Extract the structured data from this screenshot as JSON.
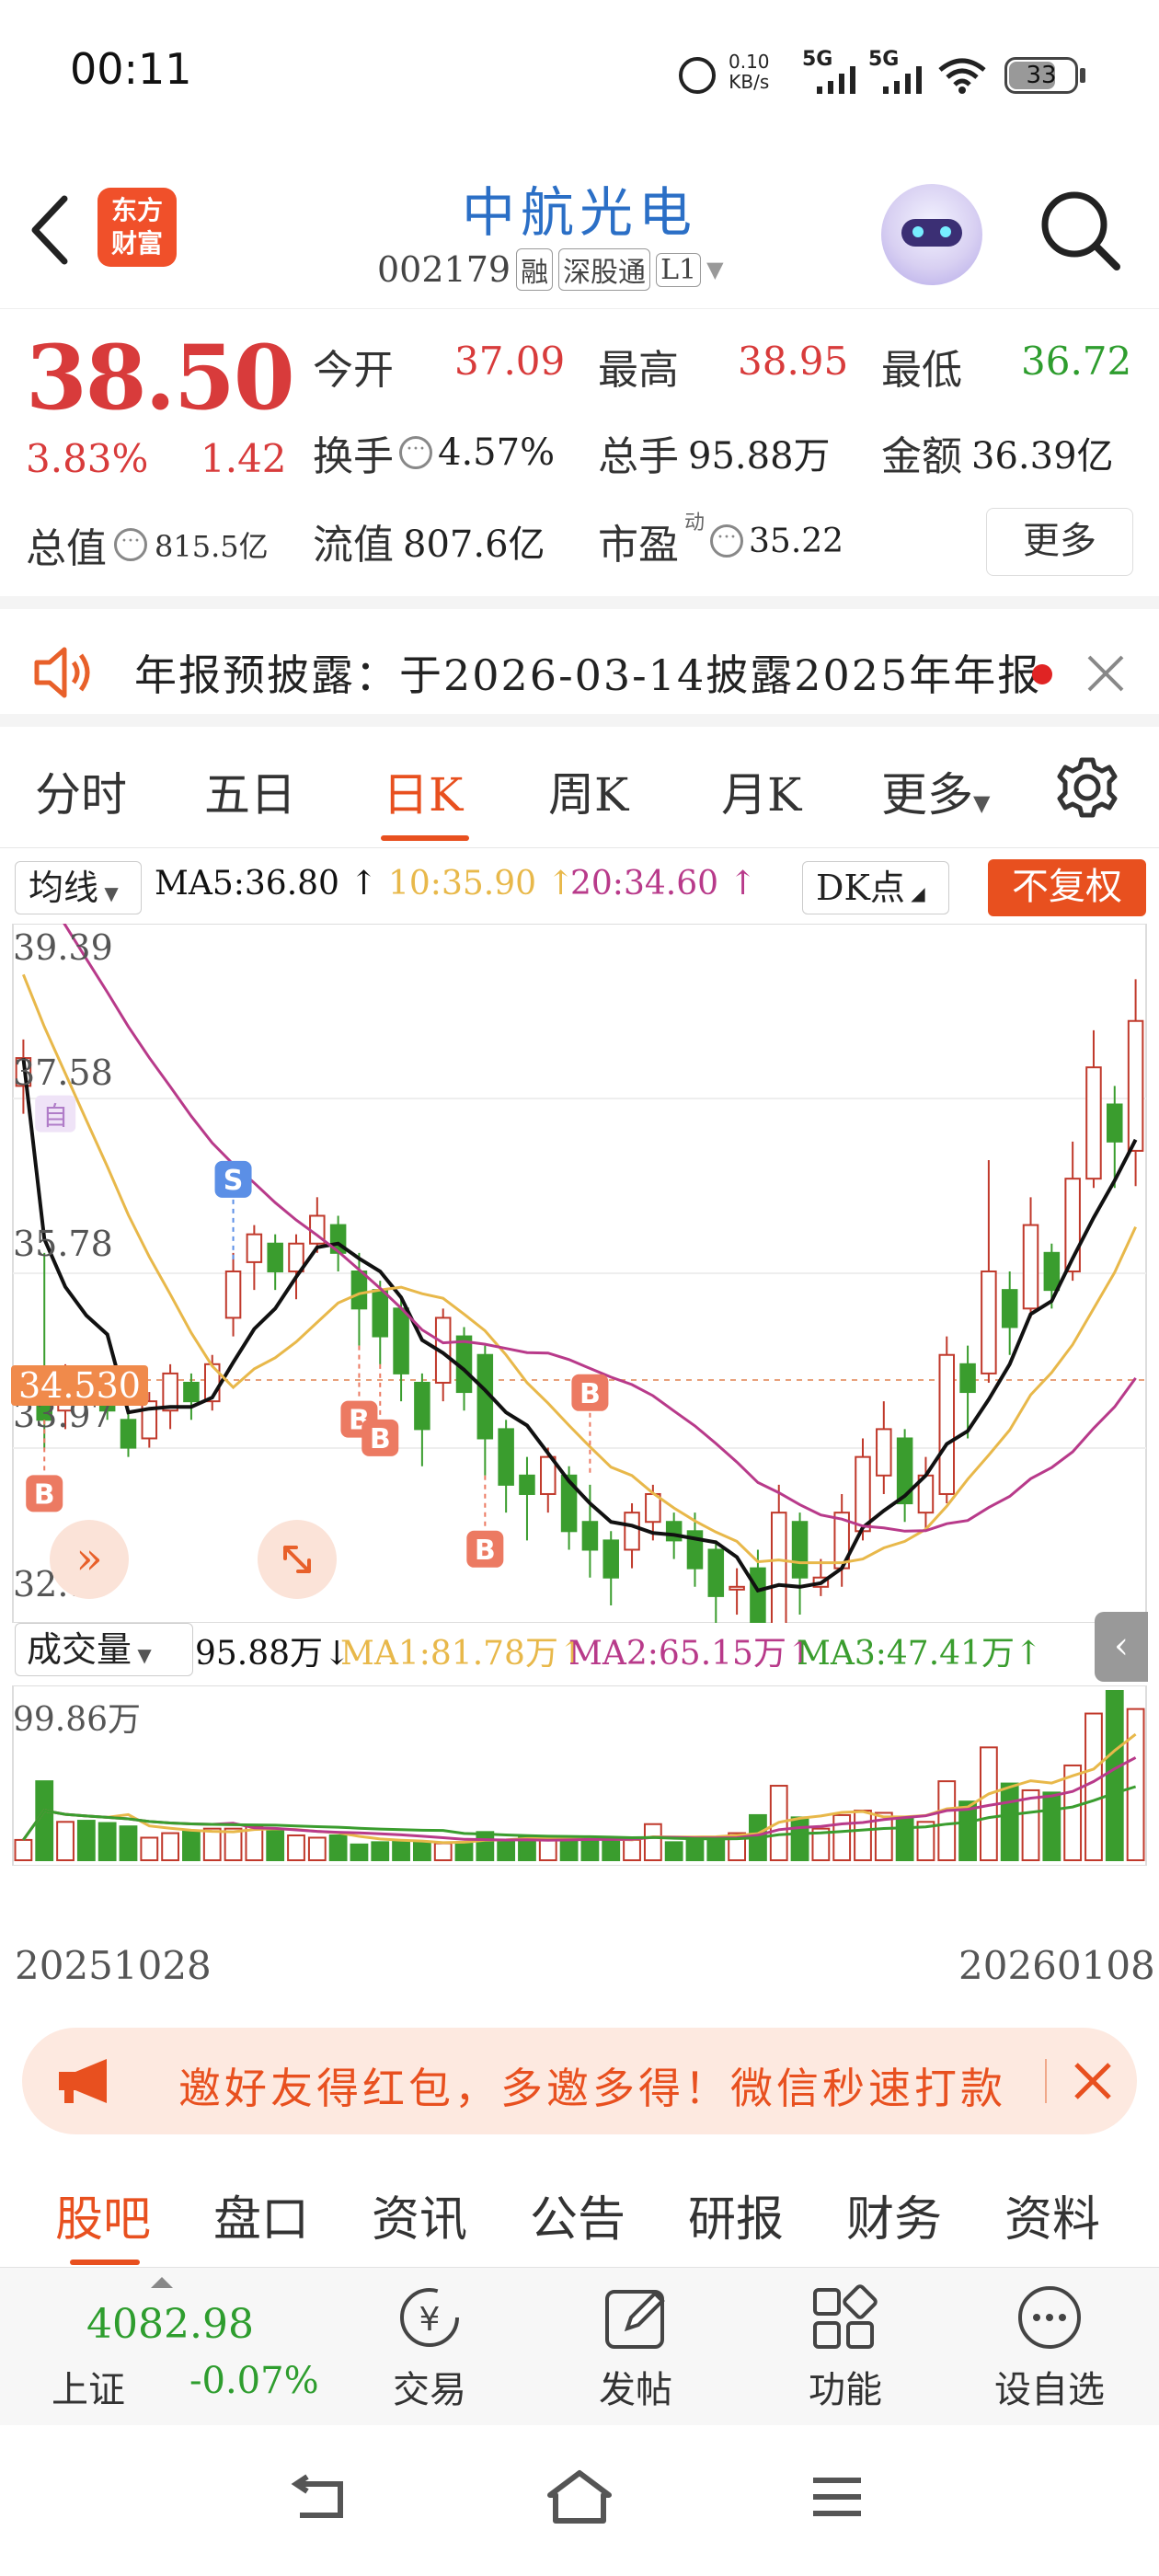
{
  "status_bar": {
    "time": "00:11",
    "net_speed_value": "0.10",
    "net_speed_unit": "KB/s",
    "sig1": "5G",
    "sig2": "5G",
    "battery": "33"
  },
  "header": {
    "logo_line1": "东方",
    "logo_line2": "财富",
    "stock_name": "中航光电",
    "stock_code": "002179",
    "tags": [
      "融",
      "深股通",
      "L1"
    ]
  },
  "quote": {
    "price": "38.50",
    "change_pct": "3.83%",
    "change_abs": "1.42",
    "open_label": "今开",
    "open_value": "37.09",
    "high_label": "最高",
    "high_value": "38.95",
    "low_label": "最低",
    "low_value": "36.72",
    "turnover_label": "换手",
    "turnover_value": "4.57%",
    "volume_label": "总手",
    "volume_value": "95.88万",
    "amount_label": "金额",
    "amount_value": "36.39亿",
    "mktcap_label": "总值",
    "mktcap_value": "815.5亿",
    "float_label": "流值",
    "float_value": "807.6亿",
    "pe_label": "市盈",
    "pe_sup": "动",
    "pe_value": "35.22",
    "more_label": "更多"
  },
  "notice": {
    "text": "年报预披露：于2026-03-14披露2025年年报"
  },
  "tabs": [
    "分时",
    "五日",
    "日K",
    "周K",
    "月K",
    "更多"
  ],
  "active_tab": "日K",
  "chart": {
    "ma_selector": "均线",
    "ma5": "MA5:36.80",
    "ma10": "10:35.90",
    "ma20": "20:34.60",
    "dk_label": "DK点",
    "adjust_label": "不复权",
    "price_current_label": "34.530",
    "y_labels": [
      "39.39",
      "37.58",
      "35.78",
      "33.97",
      "32.17"
    ],
    "vol_selector": "成交量",
    "vol_value": "95.88万",
    "vol_ma1": "MA1:81.78万",
    "vol_ma2": "MA2:65.15万",
    "vol_ma3": "MA3:47.41万",
    "vol_max_label": "99.86万",
    "date_start": "20251028",
    "date_end": "20260108",
    "marker_s": "S",
    "marker_b": "B",
    "marker_zi": "自",
    "colors": {
      "up": "#c0392b",
      "down": "#3a9d2e",
      "ma5": "#111111",
      "ma10": "#e8b84a",
      "ma20": "#b83a8a",
      "accent": "#e8501f"
    }
  },
  "chart_data": {
    "type": "candlestick",
    "ylim": [
      32.17,
      39.39
    ],
    "candles": [
      {
        "o": 37.8,
        "c": 38.1,
        "h": 38.3,
        "l": 37.5,
        "v": 18
      },
      {
        "o": 34.6,
        "c": 34.2,
        "h": 36.0,
        "l": 33.9,
        "v": 70
      },
      {
        "o": 34.3,
        "c": 34.6,
        "h": 34.8,
        "l": 34.1,
        "v": 34
      },
      {
        "o": 34.6,
        "c": 34.4,
        "h": 34.7,
        "l": 34.2,
        "v": 35
      },
      {
        "o": 34.5,
        "c": 34.3,
        "h": 34.6,
        "l": 34.2,
        "v": 33
      },
      {
        "o": 34.2,
        "c": 33.9,
        "h": 34.3,
        "l": 33.8,
        "v": 30
      },
      {
        "o": 34.0,
        "c": 34.4,
        "h": 34.5,
        "l": 33.9,
        "v": 20
      },
      {
        "o": 34.3,
        "c": 34.7,
        "h": 34.8,
        "l": 34.1,
        "v": 24
      },
      {
        "o": 34.6,
        "c": 34.4,
        "h": 34.7,
        "l": 34.2,
        "v": 26
      },
      {
        "o": 34.4,
        "c": 34.8,
        "h": 34.9,
        "l": 34.3,
        "v": 28
      },
      {
        "o": 35.3,
        "c": 35.8,
        "h": 36.0,
        "l": 35.1,
        "v": 28
      },
      {
        "o": 35.9,
        "c": 36.2,
        "h": 36.3,
        "l": 35.6,
        "v": 30
      },
      {
        "o": 36.1,
        "c": 35.8,
        "h": 36.2,
        "l": 35.6,
        "v": 28
      },
      {
        "o": 35.8,
        "c": 36.1,
        "h": 36.2,
        "l": 35.5,
        "v": 22
      },
      {
        "o": 36.1,
        "c": 36.4,
        "h": 36.6,
        "l": 36.0,
        "v": 20
      },
      {
        "o": 36.3,
        "c": 36.0,
        "h": 36.4,
        "l": 35.8,
        "v": 22
      },
      {
        "o": 35.8,
        "c": 35.4,
        "h": 36.0,
        "l": 35.0,
        "v": 14
      },
      {
        "o": 35.6,
        "c": 35.1,
        "h": 35.7,
        "l": 34.8,
        "v": 16
      },
      {
        "o": 35.4,
        "c": 34.7,
        "h": 35.5,
        "l": 34.4,
        "v": 17
      },
      {
        "o": 34.6,
        "c": 34.1,
        "h": 34.7,
        "l": 33.7,
        "v": 16
      },
      {
        "o": 34.6,
        "c": 35.3,
        "h": 35.4,
        "l": 34.4,
        "v": 15
      },
      {
        "o": 35.1,
        "c": 34.5,
        "h": 35.2,
        "l": 34.3,
        "v": 16
      },
      {
        "o": 34.9,
        "c": 34.0,
        "h": 35.0,
        "l": 33.6,
        "v": 25
      },
      {
        "o": 34.1,
        "c": 33.5,
        "h": 34.2,
        "l": 33.2,
        "v": 18
      },
      {
        "o": 33.6,
        "c": 33.4,
        "h": 33.8,
        "l": 32.9,
        "v": 22
      },
      {
        "o": 33.4,
        "c": 33.8,
        "h": 33.9,
        "l": 33.2,
        "v": 18
      },
      {
        "o": 33.6,
        "c": 33.0,
        "h": 33.7,
        "l": 32.8,
        "v": 17
      },
      {
        "o": 33.1,
        "c": 32.8,
        "h": 33.5,
        "l": 32.5,
        "v": 20
      },
      {
        "o": 32.9,
        "c": 32.5,
        "h": 33.0,
        "l": 32.2,
        "v": 17
      },
      {
        "o": 32.8,
        "c": 33.2,
        "h": 33.3,
        "l": 32.6,
        "v": 18
      },
      {
        "o": 33.1,
        "c": 33.4,
        "h": 33.5,
        "l": 32.9,
        "v": 32
      },
      {
        "o": 33.1,
        "c": 32.9,
        "h": 33.2,
        "l": 32.7,
        "v": 16
      },
      {
        "o": 33.0,
        "c": 32.6,
        "h": 33.2,
        "l": 32.4,
        "v": 20
      },
      {
        "o": 32.8,
        "c": 32.3,
        "h": 32.9,
        "l": 31.9,
        "v": 18
      },
      {
        "o": 32.4,
        "c": 32.4,
        "h": 32.6,
        "l": 32.1,
        "v": 24
      },
      {
        "o": 32.6,
        "c": 31.6,
        "h": 32.8,
        "l": 31.4,
        "v": 40
      },
      {
        "o": 32.0,
        "c": 33.2,
        "h": 33.5,
        "l": 31.9,
        "v": 66
      },
      {
        "o": 33.1,
        "c": 32.5,
        "h": 33.2,
        "l": 32.1,
        "v": 38
      },
      {
        "o": 32.4,
        "c": 32.5,
        "h": 32.7,
        "l": 32.3,
        "v": 28
      },
      {
        "o": 32.6,
        "c": 33.2,
        "h": 33.4,
        "l": 32.4,
        "v": 40
      },
      {
        "o": 33.0,
        "c": 33.8,
        "h": 34.0,
        "l": 32.9,
        "v": 44
      },
      {
        "o": 33.6,
        "c": 34.1,
        "h": 34.4,
        "l": 33.4,
        "v": 42
      },
      {
        "o": 34.0,
        "c": 33.3,
        "h": 34.1,
        "l": 33.1,
        "v": 38
      },
      {
        "o": 33.2,
        "c": 33.6,
        "h": 33.8,
        "l": 33.0,
        "v": 34
      },
      {
        "o": 33.4,
        "c": 34.9,
        "h": 35.1,
        "l": 33.3,
        "v": 70
      },
      {
        "o": 34.8,
        "c": 34.5,
        "h": 35.0,
        "l": 34.0,
        "v": 52
      },
      {
        "o": 34.7,
        "c": 35.8,
        "h": 37.0,
        "l": 34.6,
        "v": 100
      },
      {
        "o": 35.6,
        "c": 35.2,
        "h": 35.8,
        "l": 34.9,
        "v": 68
      },
      {
        "o": 35.4,
        "c": 36.3,
        "h": 36.6,
        "l": 35.3,
        "v": 62
      },
      {
        "o": 36.0,
        "c": 35.6,
        "h": 36.1,
        "l": 35.4,
        "v": 60
      },
      {
        "o": 35.8,
        "c": 36.8,
        "h": 37.2,
        "l": 35.7,
        "v": 84
      },
      {
        "o": 36.8,
        "c": 38.0,
        "h": 38.4,
        "l": 36.7,
        "v": 130
      },
      {
        "o": 37.6,
        "c": 37.2,
        "h": 37.8,
        "l": 36.7,
        "v": 150
      },
      {
        "o": 37.1,
        "c": 38.5,
        "h": 38.95,
        "l": 36.72,
        "v": 134
      }
    ]
  },
  "banner": {
    "text": "邀好友得红包，多邀多得！微信秒速打款"
  },
  "bottom_tabs": [
    "股吧",
    "盘口",
    "资讯",
    "公告",
    "研报",
    "财务",
    "资料"
  ],
  "active_bottom_tab": "股吧",
  "toolbar": {
    "index_value": "4082.98",
    "index_name": "上证",
    "index_change": "-0.07%",
    "trade": "交易",
    "post": "发帖",
    "functions": "功能",
    "watchlist": "设自选"
  }
}
